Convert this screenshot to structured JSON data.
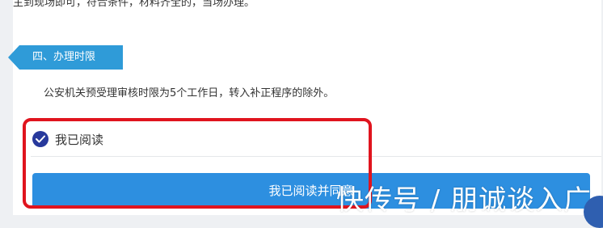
{
  "intro_text": "主到现场即可，符合条件，材料齐全的，当场办理。",
  "section": {
    "tag_label": "四、办理时限",
    "body": "公安机关预受理审核时限为5个工作日，转入补正程序的除外。"
  },
  "agreement": {
    "read_label": "我已阅读",
    "checked": true,
    "button_label": "我已阅读并同意"
  },
  "watermark": "快传号 / 朋诚谈入广",
  "colors": {
    "tag": "#2f9bd8",
    "check": "#27399c",
    "button": "#2d8fe0",
    "highlight": "#e0141e"
  }
}
